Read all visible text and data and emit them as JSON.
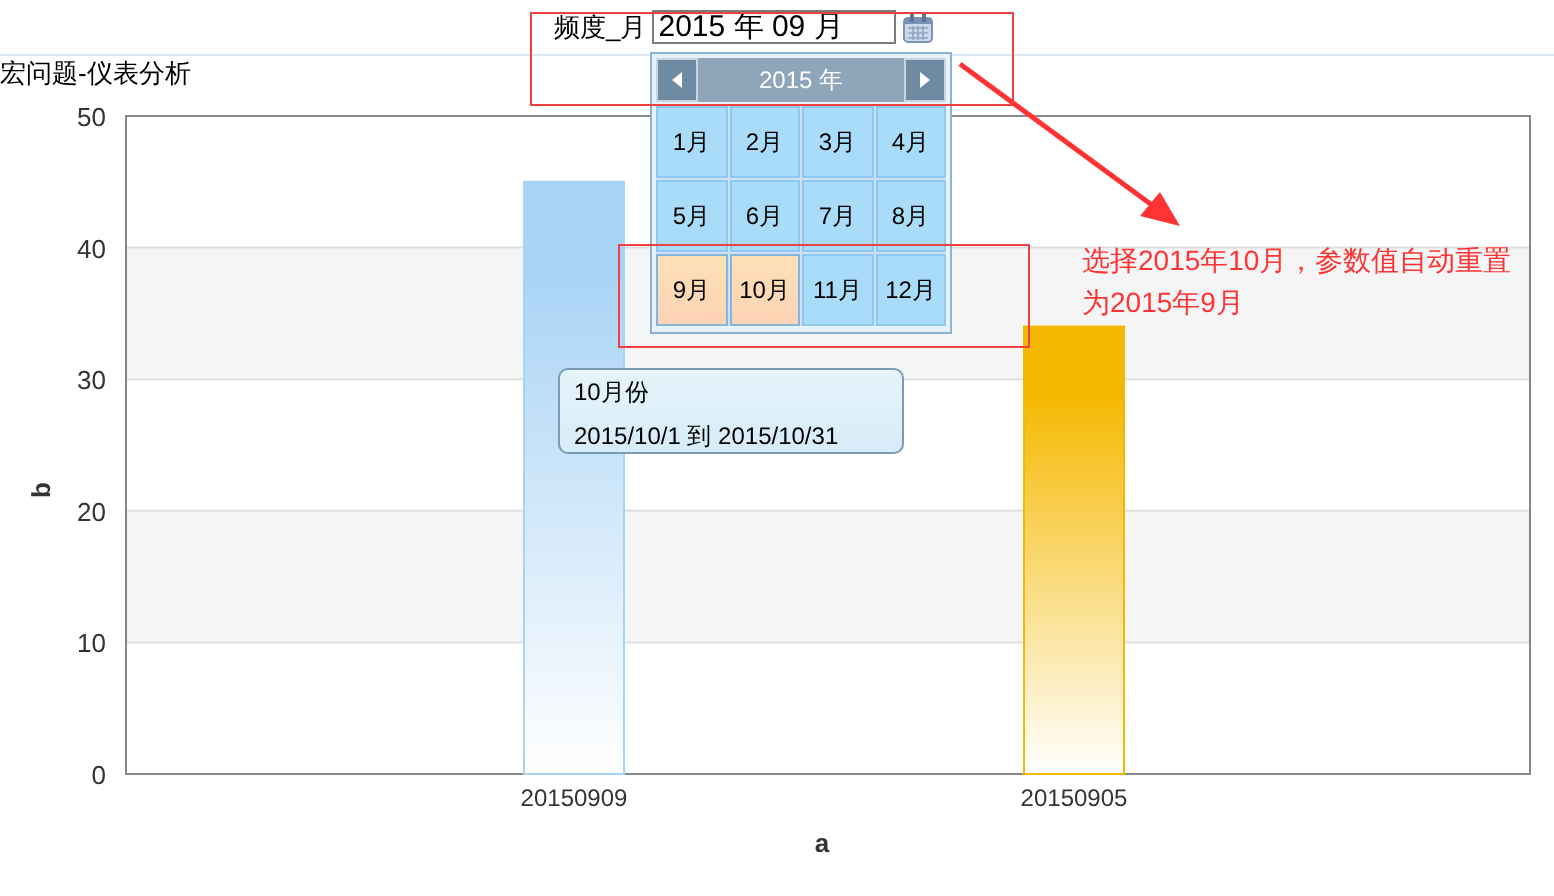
{
  "filter": {
    "label": "频度_月",
    "value": "2015 年 09 月"
  },
  "chart": {
    "title": "宏问题-仪表分析",
    "chart_data": {
      "type": "bar",
      "xlabel": "a",
      "ylabel": "b",
      "categories": [
        "20150909",
        "20150905"
      ],
      "series": [
        {
          "color": "#a9d3f5",
          "values": [
            45,
            null
          ]
        },
        {
          "color": "#f5b800",
          "values": [
            null,
            34
          ]
        }
      ],
      "grid": true,
      "ylim": [
        0,
        50
      ],
      "yticks": [
        0,
        10,
        20,
        30,
        40,
        50
      ]
    }
  },
  "calendar": {
    "year": "2015 年",
    "months": [
      {
        "label": "1月",
        "selected": false
      },
      {
        "label": "2月",
        "selected": false
      },
      {
        "label": "3月",
        "selected": false
      },
      {
        "label": "4月",
        "selected": false
      },
      {
        "label": "5月",
        "selected": false
      },
      {
        "label": "6月",
        "selected": false
      },
      {
        "label": "7月",
        "selected": false
      },
      {
        "label": "8月",
        "selected": false
      },
      {
        "label": "9月",
        "selected": true
      },
      {
        "label": "10月",
        "selected": true
      },
      {
        "label": "11月",
        "selected": false
      },
      {
        "label": "12月",
        "selected": false
      }
    ]
  },
  "tooltip": {
    "title": "10月份",
    "range": "2015/10/1 到 2015/10/31"
  },
  "annotation": {
    "text": "选择2015年10月，参数值自动重置为2015年9月"
  }
}
